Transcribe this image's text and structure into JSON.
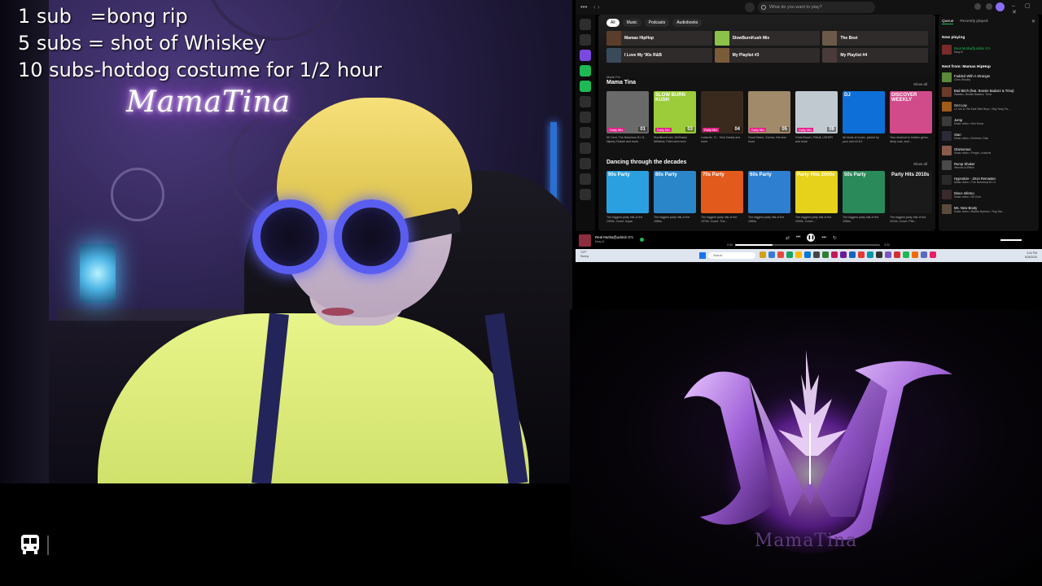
{
  "overlay": {
    "lines": [
      "1 sub   =bong rip",
      "5 subs = shot of Whiskey",
      "10 subs-hotdog costume for 1/2 hour"
    ]
  },
  "webcam": {
    "neon_sign": "MamaTina"
  },
  "icons": {
    "bottom_left": "bus-icon"
  },
  "spotify": {
    "search_placeholder": "What do you want to play?",
    "filter_chips": [
      "All",
      "Music",
      "Podcasts",
      "Audiobooks"
    ],
    "quick_access": [
      {
        "label": "Mamas HipHop",
        "color": "#5a3d2b"
      },
      {
        "label": "SlowBurnKush Mix",
        "color": "#8bc34a"
      },
      {
        "label": "The Best",
        "color": "#6b5a4a"
      },
      {
        "label": "I Love My '90s R&B",
        "color": "#3a4a5a"
      },
      {
        "label": "My Playlist #3",
        "color": "#7a5b3a"
      },
      {
        "label": "My Playlist #4",
        "color": "#4a3a3a"
      }
    ],
    "made_for": {
      "subtitle": "Made For",
      "title": "Mama Tina",
      "show_all": "Show all",
      "cards": [
        {
          "label": "",
          "tag": "Daily Mix",
          "num": "01",
          "color": "#6a6a6a",
          "desc": "50 Cent, The Notorious B.I.G., Nipsey Hussle and more"
        },
        {
          "label": "SLOW BURN KUSH",
          "tag": "Daily Mix",
          "num": "03",
          "color": "#9ccc3a",
          "desc": "SlowBurnKush, DeShawn Williams, Palm and more"
        },
        {
          "label": "",
          "tag": "Daily Mix",
          "num": "04",
          "color": "#3a2a1e",
          "desc": "Ludacris, T.I., Trick Daddy and more"
        },
        {
          "label": "",
          "tag": "Daily Mix",
          "num": "05",
          "color": "#a08a6a",
          "desc": "Gucci Mane, Gunna, Hot and more"
        },
        {
          "label": "",
          "tag": "Daily Mix",
          "num": "06",
          "color": "#c0c8d0",
          "desc": "Chris Brown, Pitbull, USHER and more"
        },
        {
          "label": "DJ",
          "tag": "",
          "num": "",
          "color": "#0e6fd8",
          "desc": "All kinds of music, picked by your own AI DJ."
        },
        {
          "label": "DISCOVER WEEKLY",
          "tag": "",
          "num": "",
          "color": "#d14b8a",
          "desc": "Your shortcut to hidden gems, deep cuts, and..."
        }
      ]
    },
    "decades": {
      "title": "Dancing through the decades",
      "show_all": "Show all",
      "cards": [
        {
          "label": "90s Party",
          "color": "#2aa0e0",
          "desc": "The biggest party hits of the 1990s. Cover: Aqua"
        },
        {
          "label": "80s Party",
          "color": "#2b86c9",
          "desc": "The biggest party hits of the 1980s."
        },
        {
          "label": "70s Party",
          "color": "#e25a1c",
          "desc": "The biggest party hits of the 1970s. Cover: The..."
        },
        {
          "label": "60s Party",
          "color": "#2f7fd0",
          "desc": "The biggest party hits of the 1960s."
        },
        {
          "label": "Party Hits 2000s",
          "color": "#e6d21a",
          "desc": "The biggest party hits of the 2000s. Cover:..."
        },
        {
          "label": "50s Party",
          "color": "#2a8a5a",
          "desc": "The biggest party hits of the 1950s."
        },
        {
          "label": "Party Hits 2010s",
          "color": "#1a1a1a",
          "desc": "The biggest party hits of the 2010s. Cover: Pitb..."
        }
      ]
    },
    "queue": {
      "tabs": [
        "Queue",
        "Recently played"
      ],
      "now_playing_label": "Now playing",
      "now_playing": {
        "title": "Real Mutha(f)uckkin G's",
        "artist": "Eazy-E",
        "color": "#7a2a2a"
      },
      "next_from_label": "Next from: Mamas HipHop",
      "items": [
        {
          "title": "Fadded With A Stranger",
          "artist": "Chris Wooley",
          "color": "#5a8a3a"
        },
        {
          "title": "Bad Bitch (feat. Boosie Badazz & Trina)",
          "artist": "Waldiox, Boosie Badazz, Trina",
          "color": "#6a3a2a"
        },
        {
          "title": "Get Low",
          "artist": "Lil Jon & The East Side Boyz, Ying Yang Tw...",
          "color": "#a05a1a"
        },
        {
          "title": "Jump",
          "artist": "Music video • Kris Kross",
          "color": "#3a3a3a"
        },
        {
          "title": "Stan",
          "artist": "Music video • Eminem, Dido",
          "color": "#2a2a3a"
        },
        {
          "title": "Glamorous",
          "artist": "Music video • Fergie, Ludacris",
          "color": "#8a5a4a"
        },
        {
          "title": "Rump Shaker",
          "artist": "Wreckx-N-Effect",
          "color": "#4a4a4a"
        },
        {
          "title": "Hypnotize - 2014 Remaster",
          "artist": "Music video • The Notorious B.I.G.",
          "color": "#2a2a2a"
        },
        {
          "title": "Disco Inferno",
          "artist": "Music video • 50 Cent",
          "color": "#3a2a2a"
        },
        {
          "title": "Ms. New Booty",
          "artist": "Music video • Bubba Sparxxx, Ying Yan...",
          "color": "#5a4a3a"
        }
      ]
    },
    "player": {
      "track": "Real Mutha(f)uckkin G's",
      "artist": "Eazy-E",
      "elapsed": "0:55",
      "duration": "3:32",
      "progress": 0.26
    },
    "taskbar": {
      "search": "Search",
      "weather_temp": "74°F",
      "weather_desc": "Sunny",
      "time": "3:34 PM",
      "date": "5/26/2025",
      "app_colors": [
        "#d4a017",
        "#3a7bd5",
        "#e54b3c",
        "#1aa260",
        "#ffb900",
        "#0078d4",
        "#444",
        "#2f7d32",
        "#c2185b",
        "#6a1b9a",
        "#1565c0",
        "#e53935",
        "#0097a7",
        "#333",
        "#7e57c2",
        "#d32f2f",
        "#1db954",
        "#ef6c00",
        "#5c6bc0",
        "#e91e63"
      ]
    }
  },
  "logo": {
    "wordmark": "MamaTina"
  }
}
